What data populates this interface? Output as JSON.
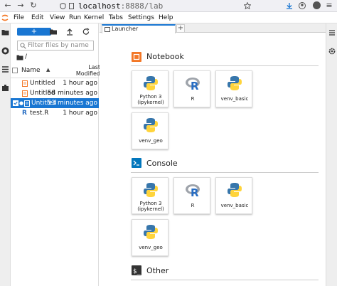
{
  "browser": {
    "url_host": "localhost",
    "url_rest": ":8888/lab"
  },
  "menu": {
    "items": [
      "File",
      "Edit",
      "View",
      "Run",
      "Kernel",
      "Tabs",
      "Settings",
      "Help"
    ]
  },
  "filebrowser": {
    "new_label": "+",
    "filter_placeholder": "Filter files by name",
    "breadcrumb": "/",
    "col_name": "Name",
    "col_modified": "Last Modified",
    "files": [
      {
        "name": "Untitled",
        "modified": "1 hour ago",
        "type": "notebook"
      },
      {
        "name": "Untitled",
        "modified": "58 minutes ago",
        "type": "notebook"
      },
      {
        "name": "Untitled",
        "modified": "53 minutes ago",
        "type": "notebook",
        "selected": true
      },
      {
        "name": "test.R",
        "modified": "1 hour ago",
        "type": "r"
      }
    ]
  },
  "tabs": {
    "launcher_label": "Launcher",
    "add_label": "+"
  },
  "launcher": {
    "notebook_title": "Notebook",
    "console_title": "Console",
    "other_title": "Other",
    "notebook_cards": [
      {
        "label": "Python 3 (ipykernel)",
        "icon": "python-icon"
      },
      {
        "label": "R",
        "icon": "r-icon"
      },
      {
        "label": "venv_basic",
        "icon": "python-icon"
      },
      {
        "label": "venv_geo",
        "icon": "python-icon"
      }
    ],
    "console_cards": [
      {
        "label": "Python 3 (ipykernel)",
        "icon": "python-icon"
      },
      {
        "label": "R",
        "icon": "r-icon"
      },
      {
        "label": "venv_basic",
        "icon": "python-icon"
      },
      {
        "label": "venv_geo",
        "icon": "python-icon"
      }
    ]
  },
  "colors": {
    "accent": "#1976d2",
    "notebook_icon": "#f37726",
    "console_icon": "#0277bd",
    "other_icon": "#333333"
  }
}
